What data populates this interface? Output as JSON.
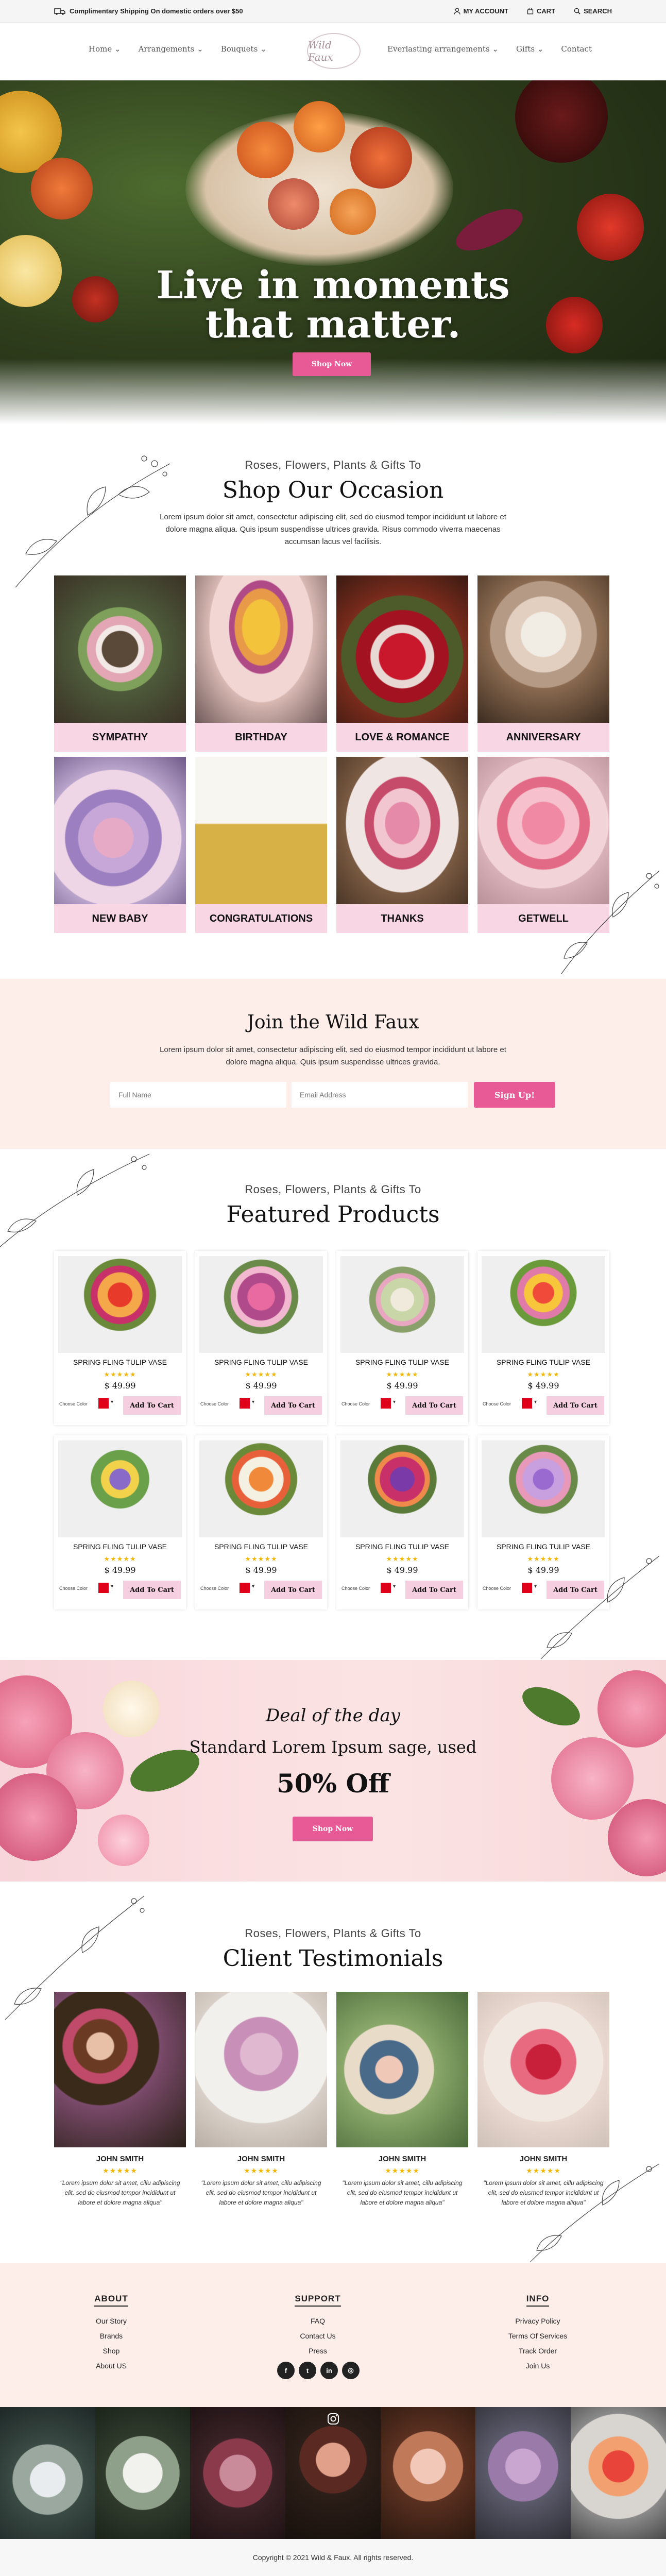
{
  "topbar": {
    "shipping": "Complimentary Shipping On domestic orders over $50",
    "account": "MY ACCOUNT",
    "cart": "CART",
    "search": "SEARCH"
  },
  "nav": {
    "logo": "Wild Faux",
    "left": [
      {
        "label": "Home",
        "has_dropdown": true
      },
      {
        "label": "Arrangements",
        "has_dropdown": true
      },
      {
        "label": "Bouquets",
        "has_dropdown": true
      }
    ],
    "right": [
      {
        "label": "Everlasting arrangements",
        "has_dropdown": true
      },
      {
        "label": "Gifts",
        "has_dropdown": true
      },
      {
        "label": "Contact",
        "has_dropdown": false
      }
    ]
  },
  "hero": {
    "line1": "Live in moments",
    "line2": "that matter.",
    "button": "Shop Now"
  },
  "occasion": {
    "subtitle": "Roses, Flowers, Plants & Gifts To",
    "title": "Shop Our Occasion",
    "text": "Lorem ipsum dolor sit amet, consectetur adipiscing elit, sed do eiusmod tempor incididunt ut labore et dolore magna aliqua. Quis ipsum suspendisse ultrices gravida. Risus commodo viverra maecenas accumsan lacus vel facilisis.",
    "items": [
      "SYMPATHY",
      "BIRTHDAY",
      "LOVE & ROMANCE",
      "ANNIVERSARY",
      "NEW BABY",
      "CONGRATULATIONS",
      "THANKS",
      "GETWELL"
    ]
  },
  "join": {
    "title": "Join the Wild Faux",
    "text": "Lorem ipsum dolor sit amet, consectetur adipiscing elit, sed do eiusmod tempor incididunt ut labore et dolore magna aliqua. Quis ipsum suspendisse ultrices gravida.",
    "name_placeholder": "Full Name",
    "email_placeholder": "Email Address",
    "button": "Sign Up!"
  },
  "featured": {
    "subtitle": "Roses, Flowers, Plants & Gifts To",
    "title": "Featured Products",
    "choose_color": "Choose Color",
    "add_to_cart": "Add To Cart",
    "products": [
      {
        "name": "SPRING FLING TULIP VASE",
        "price": "$ 49.99",
        "rating": 5
      },
      {
        "name": "SPRING FLING TULIP VASE",
        "price": "$ 49.99",
        "rating": 5
      },
      {
        "name": "SPRING FLING TULIP VASE",
        "price": "$ 49.99",
        "rating": 5
      },
      {
        "name": "SPRING FLING TULIP VASE",
        "price": "$ 49.99",
        "rating": 5
      },
      {
        "name": "SPRING FLING TULIP VASE",
        "price": "$ 49.99",
        "rating": 5
      },
      {
        "name": "SPRING FLING TULIP VASE",
        "price": "$ 49.99",
        "rating": 5
      },
      {
        "name": "SPRING FLING TULIP VASE",
        "price": "$ 49.99",
        "rating": 5
      },
      {
        "name": "SPRING FLING TULIP VASE",
        "price": "$ 49.99",
        "rating": 5
      }
    ],
    "swatch_color": "#e0001a"
  },
  "deal": {
    "script": "Deal of the day",
    "subtitle": "Standard Lorem Ipsum sage, used",
    "offer": "50% Off",
    "button": "Shop Now"
  },
  "testimonials": {
    "subtitle": "Roses, Flowers, Plants & Gifts To",
    "title": "Client Testimonials",
    "items": [
      {
        "name": "JOHN SMITH",
        "rating": 5,
        "quote": "\"Lorem ipsum dolor sit amet, cillu adipiscing elit, sed do eiusmod tempor incididunt ut labore et dolore magna aliqua\""
      },
      {
        "name": "JOHN SMITH",
        "rating": 5,
        "quote": "\"Lorem ipsum dolor sit amet, cillu adipiscing elit, sed do eiusmod tempor incididunt ut labore et dolore magna aliqua\""
      },
      {
        "name": "JOHN SMITH",
        "rating": 5,
        "quote": "\"Lorem ipsum dolor sit amet, cillu adipiscing elit, sed do eiusmod tempor incididunt ut labore et dolore magna aliqua\""
      },
      {
        "name": "JOHN SMITH",
        "rating": 5,
        "quote": "\"Lorem ipsum dolor sit amet, cillu adipiscing elit, sed do eiusmod tempor incididunt ut labore et dolore magna aliqua\""
      }
    ]
  },
  "footer": {
    "columns": [
      {
        "title": "ABOUT",
        "links": [
          "Our Story",
          "Brands",
          "Shop",
          "About US"
        ]
      },
      {
        "title": "SUPPORT",
        "links": [
          "FAQ",
          "Contact Us",
          "Press"
        ]
      },
      {
        "title": "INFO",
        "links": [
          "Privacy Policy",
          "Terms Of Services",
          "Track Order",
          "Join Us"
        ]
      }
    ],
    "social": [
      "facebook-icon",
      "twitter-icon",
      "linkedin-icon",
      "instagram-icon"
    ],
    "copyright": "Copyright © 2021 Wild & Faux. All rights reserved."
  },
  "colors": {
    "accent": "#e85a95",
    "pink_label": "#f8d6e4",
    "blush_bg": "#fdeee9"
  }
}
